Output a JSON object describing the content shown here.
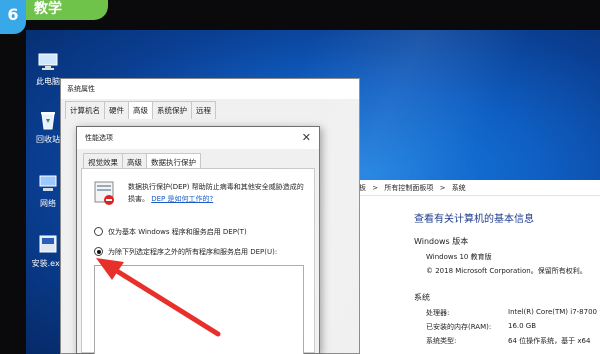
{
  "watermark": {
    "logo": "6",
    "text": "教学"
  },
  "desktop_icons": [
    {
      "label": "此电脑"
    },
    {
      "label": "回收站"
    },
    {
      "label": "网络"
    },
    {
      "label": "安装.exe"
    }
  ],
  "control_panel": {
    "breadcrumb": [
      "控制面板",
      ">",
      "所有控制面板项",
      ">",
      "系统"
    ],
    "heading": "查看有关计算机的基本信息",
    "section_windows": "Windows 版本",
    "edition": "Windows 10 教育版",
    "copyright": "© 2018 Microsoft Corporation。保留所有权利。",
    "section_system": "系统",
    "rows": [
      {
        "label": "处理器:",
        "value": "Intel(R) Core(TM) i7-8700"
      },
      {
        "label": "已安装的内存(RAM):",
        "value": "16.0 GB"
      },
      {
        "label": "系统类型:",
        "value": "64 位操作系统，基于 x64"
      }
    ]
  },
  "system_properties": {
    "title": "系统属性",
    "tabs": [
      "计算机名",
      "硬件",
      "高级",
      "系统保护",
      "远程"
    ],
    "active_tab": "高级"
  },
  "performance_options": {
    "title": "性能选项",
    "close": "✕",
    "tabs": [
      "视觉效果",
      "高级",
      "数据执行保护"
    ],
    "active_tab": "数据执行保护",
    "description": "数据执行保护(DEP) 帮助防止病毒和其他安全威胁造成的损害。",
    "link": "DEP 是如何工作的?",
    "option_basic": "仅为基本 Windows 程序和服务启用 DEP(T)",
    "option_all": "为除下列选定程序之外的所有程序和服务启用 DEP(U):",
    "selected_option": "option_all"
  },
  "colors": {
    "arrow": "#e8302a",
    "badge": "#6fc24a",
    "accent": "#1a5dc8"
  }
}
